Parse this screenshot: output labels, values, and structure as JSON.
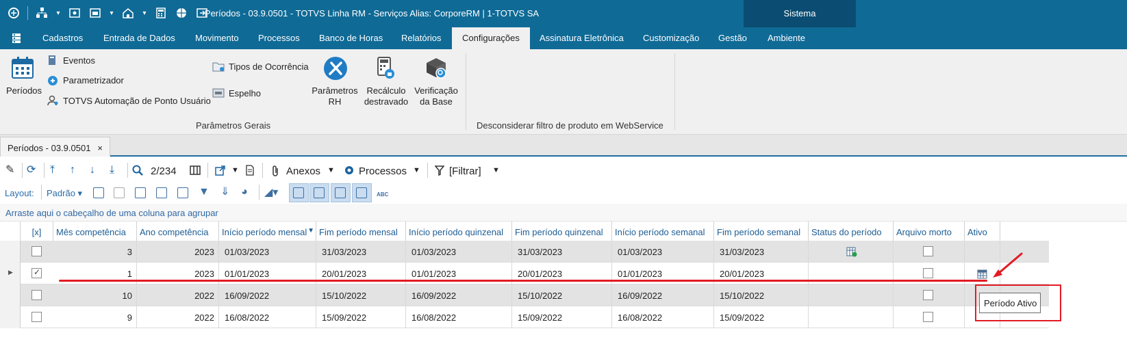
{
  "window": {
    "title": "Períodos - 03.9.0501 - TOTVS Linha RM - Serviços  Alias: CorporeRM | 1-TOTVS SA",
    "system_label": "Sistema"
  },
  "menu": {
    "items": [
      "Cadastros",
      "Entrada de Dados",
      "Movimento",
      "Processos",
      "Banco de Horas",
      "Relatórios",
      "Configurações",
      "Assinatura Eletrônica",
      "Customização",
      "Gestão",
      "Ambiente"
    ],
    "active": "Configurações"
  },
  "ribbon": {
    "periodos": "Períodos",
    "eventos": "Eventos",
    "parametrizador": "Parametrizador",
    "automacao": "TOTVS Automação de Ponto Usuário",
    "tipos_ocorrencia": "Tipos de Ocorrência",
    "espelho": "Espelho",
    "parametros_rh_1": "Parâmetros",
    "parametros_rh_2": "RH",
    "recalculo_1": "Recálculo",
    "recalculo_2": "destravado",
    "verificacao_1": "Verificação",
    "verificacao_2": "da Base",
    "group_parametros_gerais": "Parâmetros Gerais",
    "group_webservice": "Desconsiderar filtro de produto em WebService"
  },
  "doc_tab": {
    "label": "Períodos - 03.9.0501",
    "close": "×"
  },
  "toolbar": {
    "record_position": "2/234",
    "anexos": "Anexos",
    "processos": "Processos",
    "filtrar": "[Filtrar]",
    "layout_label": "Layout:",
    "layout_value": "Padrão"
  },
  "group_hint": "Arraste aqui o cabeçalho de uma coluna para agrupar",
  "grid": {
    "columns": [
      "[x]",
      "Mês competência",
      "Ano competência",
      "Início período mensal",
      "Fim período mensal",
      "Início período quinzenal",
      "Fim período quinzenal",
      "Início período semanal",
      "Fim período semanal",
      "Status do período",
      "Arquivo morto",
      "Ativo"
    ],
    "rows": [
      {
        "checked": false,
        "mes": "3",
        "ano": "2023",
        "ini_mensal": "01/03/2023",
        "fim_mensal": "31/03/2023",
        "ini_quinzenal": "01/03/2023",
        "fim_quinzenal": "31/03/2023",
        "ini_semanal": "01/03/2023",
        "fim_semanal": "31/03/2023"
      },
      {
        "checked": true,
        "mes": "1",
        "ano": "2023",
        "ini_mensal": "01/01/2023",
        "fim_mensal": "20/01/2023",
        "ini_quinzenal": "01/01/2023",
        "fim_quinzenal": "20/01/2023",
        "ini_semanal": "01/01/2023",
        "fim_semanal": "20/01/2023"
      },
      {
        "checked": false,
        "mes": "10",
        "ano": "2022",
        "ini_mensal": "16/09/2022",
        "fim_mensal": "15/10/2022",
        "ini_quinzenal": "16/09/2022",
        "fim_quinzenal": "15/10/2022",
        "ini_semanal": "16/09/2022",
        "fim_semanal": "15/10/2022"
      },
      {
        "checked": false,
        "mes": "9",
        "ano": "2022",
        "ini_mensal": "16/08/2022",
        "fim_mensal": "15/09/2022",
        "ini_quinzenal": "16/08/2022",
        "fim_quinzenal": "15/09/2022",
        "ini_semanal": "16/08/2022",
        "fim_semanal": "15/09/2022"
      }
    ]
  },
  "tooltip": "Período Ativo",
  "colors": {
    "title_bar": "#0f6a96",
    "system_block": "#0b4d72",
    "annotation_red": "#e21b23"
  }
}
